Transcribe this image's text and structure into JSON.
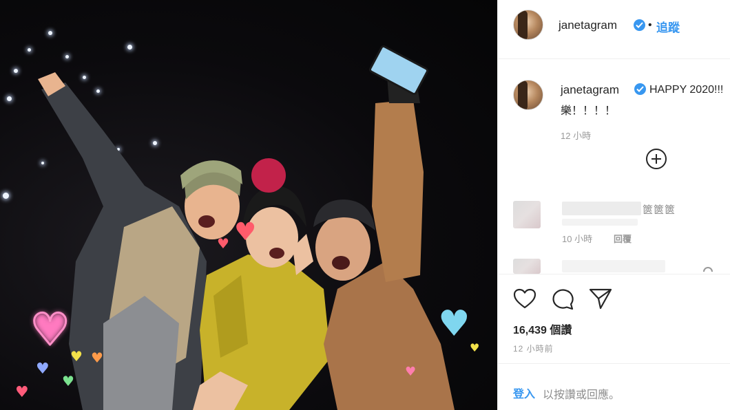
{
  "post": {
    "username": "janetagram",
    "dot": "•",
    "follow_label": "追蹤",
    "caption": "HAPPY 2020!!!",
    "caption_line2": "樂！！！！",
    "caption_time": "12 小時",
    "comment": {
      "tail": "篋篋篋",
      "time": "10 小時",
      "reply_label": "回覆"
    },
    "likes": "16,439 個讚",
    "posted_ago": "12 小時前",
    "login_link": "登入",
    "login_rest": "以按讚或回應。"
  },
  "icons": {
    "verified": "verified-badge-icon",
    "load_more": "plus-circle-icon",
    "like": "heart-outline-icon",
    "comment": "speech-bubble-icon",
    "share": "paper-plane-icon"
  },
  "colors": {
    "accent": "#3897f0",
    "text": "#262626",
    "muted": "#999999",
    "divider": "#efefef"
  }
}
